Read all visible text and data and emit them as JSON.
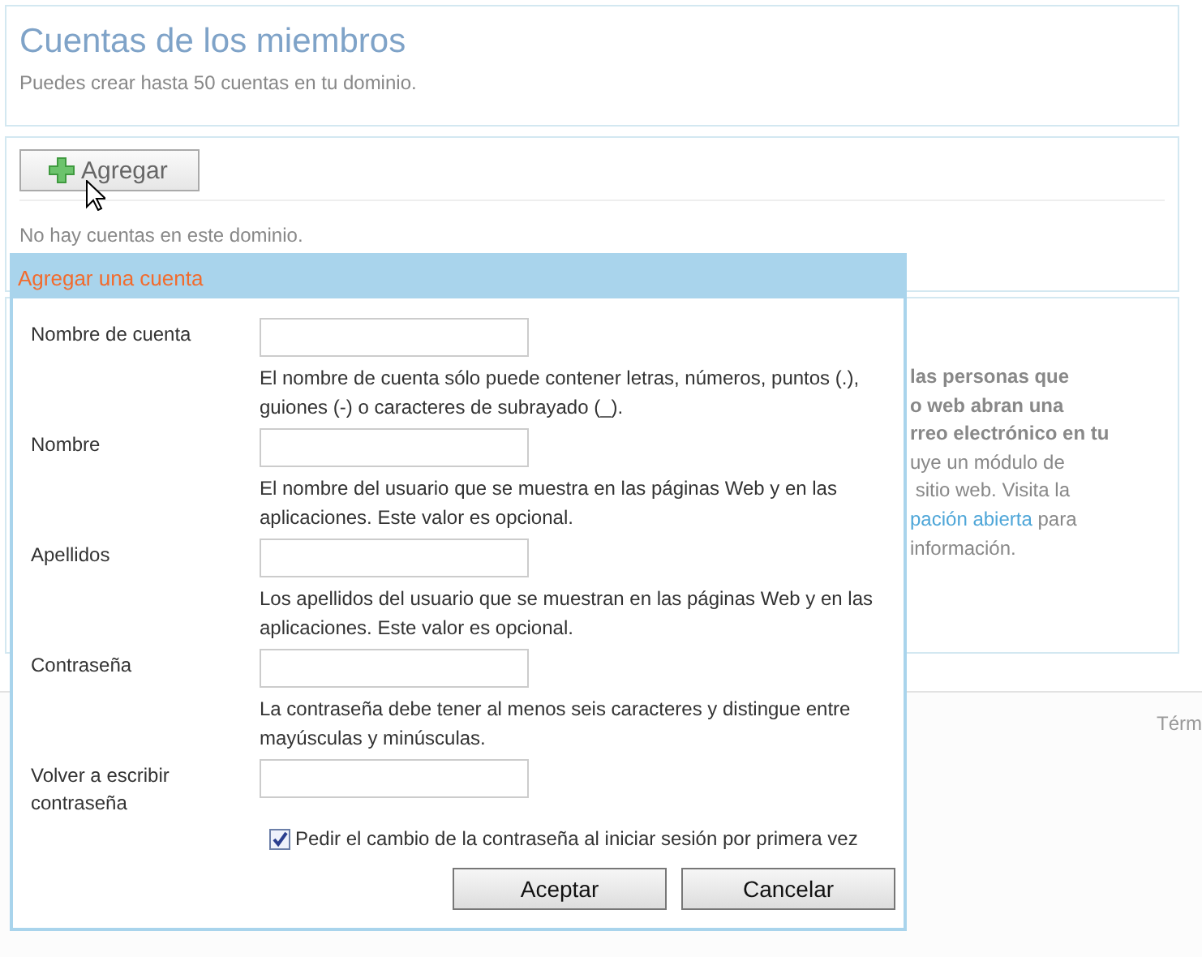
{
  "header": {
    "title": "Cuentas de los miembros",
    "subtitle": "Puedes crear hasta 50 cuentas en tu dominio."
  },
  "toolbar": {
    "add_button": "Agregar"
  },
  "empty_message": "No hay cuentas en este dominio.",
  "info_panel": {
    "lines": [
      {
        "kind": "bold",
        "text": "las personas que"
      },
      {
        "kind": "bold",
        "text": "o web abran una"
      },
      {
        "kind": "bold",
        "text": "rreo electrónico en tu"
      },
      {
        "kind": "plain",
        "text": "uye un módulo de"
      },
      {
        "kind": "plain",
        "text": " sitio web. Visita la"
      },
      {
        "kind": "link",
        "link": "pación abierta",
        "text": " para"
      },
      {
        "kind": "plain",
        "text": "información."
      }
    ]
  },
  "footer": {
    "link": "Térm"
  },
  "dialog": {
    "title": "Agregar una cuenta",
    "fields": [
      {
        "label": "Nombre de cuenta",
        "hint": "El nombre de cuenta sólo puede contener letras, números, puntos (.), guiones (-) o caracteres de subrayado (_)."
      },
      {
        "label": "Nombre",
        "hint": "El nombre del usuario que se muestra en las páginas Web y en las aplicaciones. Este valor es opcional."
      },
      {
        "label": "Apellidos",
        "hint": "Los apellidos del usuario que se muestran en las páginas Web y en las aplicaciones. Este valor es opcional."
      },
      {
        "label": "Contraseña",
        "hint": "La contraseña debe tener al menos seis caracteres y distingue entre mayúsculas y minúsculas."
      },
      {
        "label": "Volver a escribir contraseña"
      }
    ],
    "checkbox": {
      "label": "Pedir el cambio de la contraseña al iniciar sesión por primera vez",
      "checked": true
    },
    "buttons": [
      "Aceptar",
      "Cancelar"
    ]
  }
}
